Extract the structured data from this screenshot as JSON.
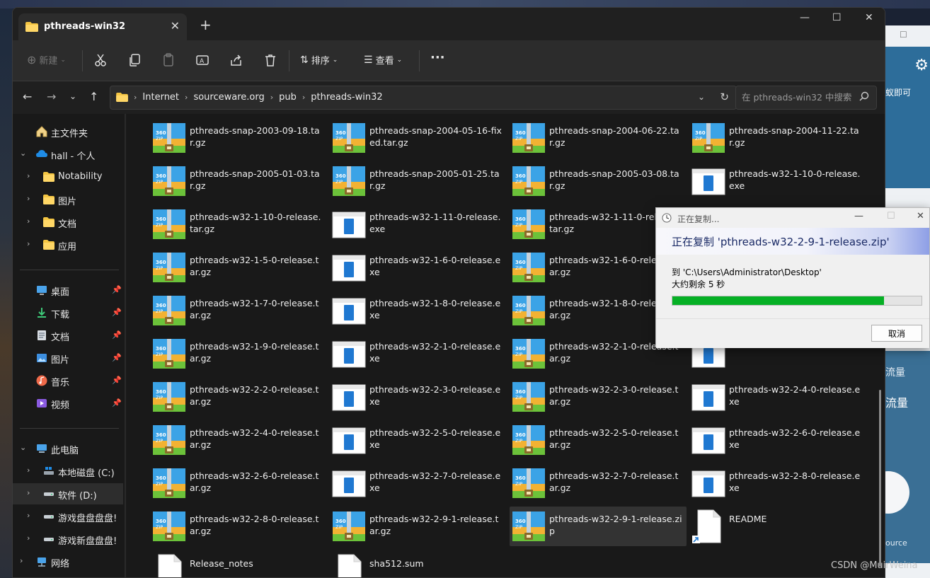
{
  "window": {
    "tab_title": "pthreads-win32",
    "new_tab_symbol": "+",
    "minimize": "—",
    "maximize": "☐",
    "close": "✕"
  },
  "toolbar": {
    "new_label": "新建",
    "sort_label": "排序",
    "view_label": "查看",
    "more_label": "···"
  },
  "address": {
    "crumbs": [
      "Internet",
      "sourceware.org",
      "pub",
      "pthreads-win32"
    ],
    "search_placeholder": "在 pthreads-win32 中搜索"
  },
  "sidebar": {
    "items": [
      {
        "label": "主文件夹",
        "icon": "home-icon"
      },
      {
        "label": "hall - 个人",
        "icon": "cloud-icon"
      },
      {
        "label": "Notability",
        "icon": "folder-icon"
      },
      {
        "label": "图片",
        "icon": "folder-icon"
      },
      {
        "label": "文档",
        "icon": "folder-icon"
      },
      {
        "label": "应用",
        "icon": "folder-icon"
      },
      {
        "label": "桌面",
        "icon": "desktop-icon"
      },
      {
        "label": "下载",
        "icon": "download-icon"
      },
      {
        "label": "文档",
        "icon": "documents-icon"
      },
      {
        "label": "图片",
        "icon": "pictures-icon"
      },
      {
        "label": "音乐",
        "icon": "music-icon"
      },
      {
        "label": "视频",
        "icon": "video-icon"
      },
      {
        "label": "此电脑",
        "icon": "computer-icon"
      },
      {
        "label": "本地磁盘 (C:)",
        "icon": "drive-c-icon"
      },
      {
        "label": "软件 (D:)",
        "icon": "drive-icon"
      },
      {
        "label": "游戏盘盘盘盘!",
        "icon": "drive-icon"
      },
      {
        "label": "游戏新盘盘盘!",
        "icon": "drive-icon"
      },
      {
        "label": "网络",
        "icon": "network-icon"
      }
    ]
  },
  "files": [
    {
      "name": "pthreads-snap-2003-09-18.tar.gz",
      "type": "zip"
    },
    {
      "name": "pthreads-snap-2004-05-16-fixed.tar.gz",
      "type": "zip"
    },
    {
      "name": "pthreads-snap-2004-06-22.tar.gz",
      "type": "zip"
    },
    {
      "name": "pthreads-snap-2004-11-22.tar.gz",
      "type": "zip"
    },
    {
      "name": "pthreads-snap-2005-01-03.tar.gz",
      "type": "zip"
    },
    {
      "name": "pthreads-snap-2005-01-25.tar.gz",
      "type": "zip"
    },
    {
      "name": "pthreads-snap-2005-03-08.tar.gz",
      "type": "zip"
    },
    {
      "name": "pthreads-w32-1-10-0-release.exe",
      "type": "exe"
    },
    {
      "name": "pthreads-w32-1-10-0-release.tar.gz",
      "type": "zip"
    },
    {
      "name": "pthreads-w32-1-11-0-release.exe",
      "type": "exe"
    },
    {
      "name": "pthreads-w32-1-11-0-release.tar.gz",
      "type": "zip"
    },
    {
      "name": "",
      "type": "hidden"
    },
    {
      "name": "pthreads-w32-1-5-0-release.tar.gz",
      "type": "zip"
    },
    {
      "name": "pthreads-w32-1-6-0-release.exe",
      "type": "exe"
    },
    {
      "name": "pthreads-w32-1-6-0-release.tar.gz",
      "type": "zip"
    },
    {
      "name": "",
      "type": "hidden"
    },
    {
      "name": "pthreads-w32-1-7-0-release.tar.gz",
      "type": "zip"
    },
    {
      "name": "pthreads-w32-1-8-0-release.exe",
      "type": "exe"
    },
    {
      "name": "pthreads-w32-1-8-0-release.tar.gz",
      "type": "zip"
    },
    {
      "name": "",
      "type": "hidden"
    },
    {
      "name": "pthreads-w32-1-9-0-release.tar.gz",
      "type": "zip"
    },
    {
      "name": "pthreads-w32-2-1-0-release.exe",
      "type": "exe"
    },
    {
      "name": "pthreads-w32-2-1-0-release.tar.gz",
      "type": "zip"
    },
    {
      "name": "",
      "type": "exe-partial"
    },
    {
      "name": "pthreads-w32-2-2-0-release.tar.gz",
      "type": "zip"
    },
    {
      "name": "pthreads-w32-2-3-0-release.exe",
      "type": "exe"
    },
    {
      "name": "pthreads-w32-2-3-0-release.tar.gz",
      "type": "zip"
    },
    {
      "name": "pthreads-w32-2-4-0-release.exe",
      "type": "exe"
    },
    {
      "name": "pthreads-w32-2-4-0-release.tar.gz",
      "type": "zip"
    },
    {
      "name": "pthreads-w32-2-5-0-release.exe",
      "type": "exe"
    },
    {
      "name": "pthreads-w32-2-5-0-release.tar.gz",
      "type": "zip"
    },
    {
      "name": "pthreads-w32-2-6-0-release.exe",
      "type": "exe"
    },
    {
      "name": "pthreads-w32-2-6-0-release.tar.gz",
      "type": "zip"
    },
    {
      "name": "pthreads-w32-2-7-0-release.exe",
      "type": "exe"
    },
    {
      "name": "pthreads-w32-2-7-0-release.tar.gz",
      "type": "zip"
    },
    {
      "name": "pthreads-w32-2-8-0-release.exe",
      "type": "exe"
    },
    {
      "name": "pthreads-w32-2-8-0-release.tar.gz",
      "type": "zip"
    },
    {
      "name": "pthreads-w32-2-9-1-release.tar.gz",
      "type": "zip"
    },
    {
      "name": "pthreads-w32-2-9-1-release.zip",
      "type": "zip",
      "selected": true
    },
    {
      "name": "README",
      "type": "doc"
    },
    {
      "name": "Release_notes",
      "type": "doc"
    },
    {
      "name": "sha512.sum",
      "type": "doc"
    }
  ],
  "dialog": {
    "title": "正在复制...",
    "header": "正在复制 'pthreads-w32-2-9-1-release.zip'",
    "destination": "到 'C:\\Users\\Administrator\\Desktop'",
    "time_left": "大约剩余 5 秒",
    "progress_fraction": 0.85,
    "cancel_label": "取消",
    "minimize": "—",
    "maximize": "☐",
    "close": "✕"
  },
  "background_app": {
    "text_top": "蚁即可",
    "text_mid1": "流量",
    "text_mid2": "流量",
    "text_bottom": "ource"
  },
  "watermark": "CSDN @MuirWeina"
}
